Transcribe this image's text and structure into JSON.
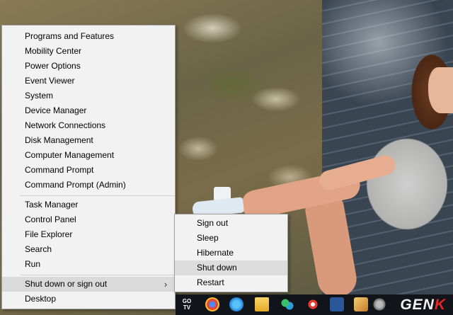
{
  "winx_menu": {
    "items": [
      {
        "label": "Programs and Features"
      },
      {
        "label": "Mobility Center"
      },
      {
        "label": "Power Options"
      },
      {
        "label": "Event Viewer"
      },
      {
        "label": "System"
      },
      {
        "label": "Device Manager"
      },
      {
        "label": "Network Connections"
      },
      {
        "label": "Disk Management"
      },
      {
        "label": "Computer Management"
      },
      {
        "label": "Command Prompt"
      },
      {
        "label": "Command Prompt (Admin)"
      },
      {
        "label": "Task Manager"
      },
      {
        "label": "Control Panel"
      },
      {
        "label": "File Explorer"
      },
      {
        "label": "Search"
      },
      {
        "label": "Run"
      },
      {
        "label": "Shut down or sign out",
        "has_submenu": true,
        "active": true
      },
      {
        "label": "Desktop"
      }
    ],
    "chevron_icon": "chevron-right-icon"
  },
  "submenu": {
    "items": [
      {
        "label": "Sign out"
      },
      {
        "label": "Sleep"
      },
      {
        "label": "Hibernate"
      },
      {
        "label": "Shut down",
        "hover": true
      },
      {
        "label": "Restart"
      }
    ]
  },
  "taskbar": {
    "go_tv_label": "GO\nTV",
    "icons": [
      "go-tv-icon",
      "chrome-icon",
      "internet-explorer-icon",
      "file-explorer-icon",
      "network-icon",
      "app-icon",
      "word-icon",
      "paint-icon",
      "settings-icon"
    ],
    "watermark": {
      "main": "GEN",
      "accent": "K"
    }
  },
  "colors": {
    "menu_bg": "#f2f2f2",
    "menu_active": "#dadada",
    "taskbar_bg": "#111419",
    "watermark_accent": "#e82424"
  }
}
